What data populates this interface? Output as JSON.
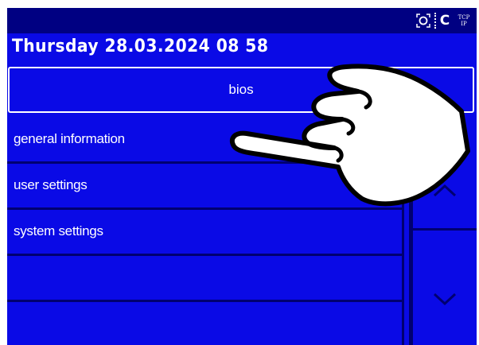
{
  "header": {
    "datetime": "Thursday  28.03.2024  08 58"
  },
  "status": {
    "icons": [
      "focus-icon",
      "c-icon",
      "tcp-ip-icon"
    ],
    "tcp_line1": "TCP",
    "tcp_line2": "IP",
    "c_label": "C"
  },
  "title": "bios",
  "menu": {
    "items": [
      {
        "label": "general information"
      },
      {
        "label": "user settings"
      },
      {
        "label": "system settings"
      },
      {
        "label": ""
      },
      {
        "label": ""
      }
    ]
  },
  "colors": {
    "screen": "#0a0ae6",
    "topbar": "#000082",
    "separator": "#000070",
    "text": "#ffffff"
  }
}
